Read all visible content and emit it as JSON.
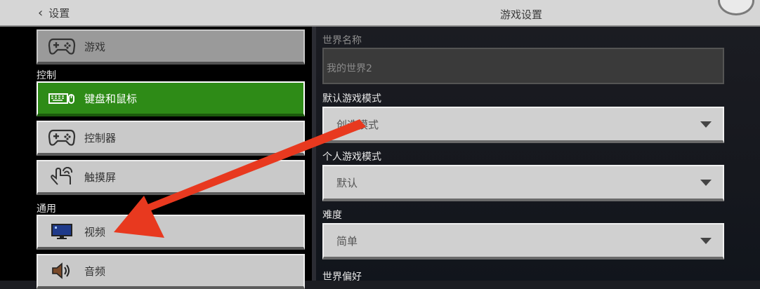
{
  "header": {
    "back_label": "设置",
    "title": "游戏设置"
  },
  "sidebar": {
    "items": [
      {
        "label": "游戏",
        "icon": "gamepad-icon",
        "state": "game"
      },
      {
        "label": "键盘和鼠标",
        "icon": "keyboard-mouse-icon",
        "state": "selected"
      },
      {
        "label": "控制器",
        "icon": "gamepad-icon",
        "state": "normal"
      },
      {
        "label": "触摸屏",
        "icon": "touch-icon",
        "state": "normal"
      },
      {
        "label": "视频",
        "icon": "monitor-icon",
        "state": "normal"
      },
      {
        "label": "音频",
        "icon": "speaker-icon",
        "state": "normal"
      }
    ],
    "sections": {
      "controls": "控制",
      "general": "通用"
    }
  },
  "settings": {
    "world_name_label": "世界名称",
    "world_name_value": "我的世界2",
    "default_mode_label": "默认游戏模式",
    "default_mode_value": "创造模式",
    "personal_mode_label": "个人游戏模式",
    "personal_mode_value": "默认",
    "difficulty_label": "难度",
    "difficulty_value": "简单",
    "world_prefs_label": "世界偏好"
  },
  "annotation": {
    "color": "#e8391f"
  },
  "colors": {
    "selected_green": "#2e8b17",
    "button_gray": "#c9c9c9",
    "panel_bg": "#1c1d22"
  }
}
